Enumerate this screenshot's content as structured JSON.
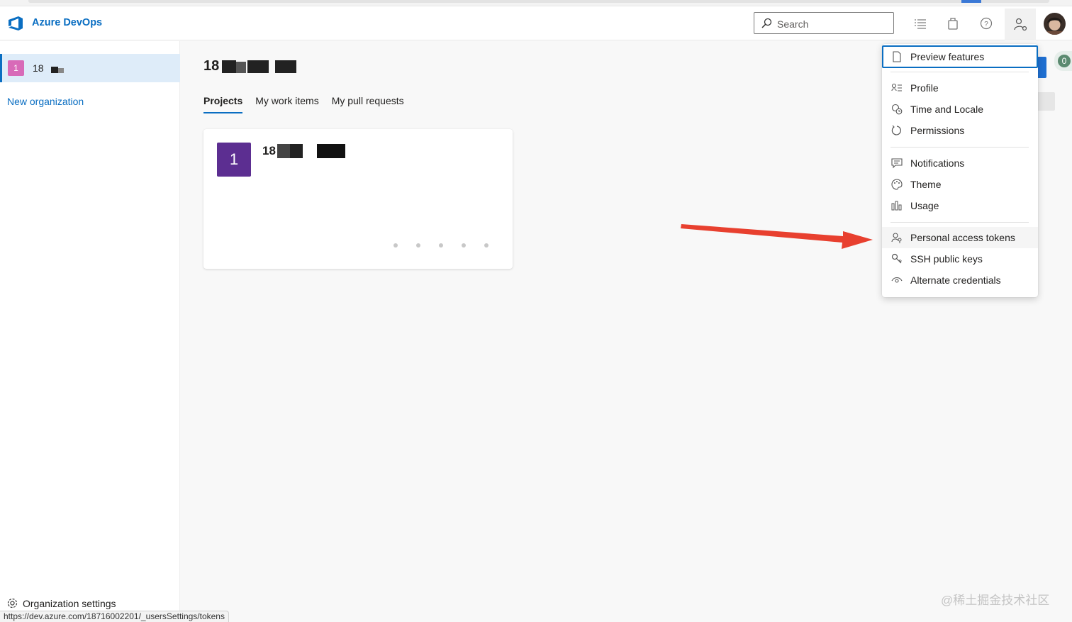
{
  "header": {
    "brand": "Azure DevOps",
    "search_placeholder": "Search",
    "icons": [
      "task-list-icon",
      "marketplace-bag-icon",
      "help-icon",
      "user-settings-icon",
      "avatar"
    ]
  },
  "sidebar": {
    "org_badge": "1",
    "org_name": "18",
    "new_org_label": "New organization",
    "org_settings_label": "Organization settings"
  },
  "main": {
    "org_title": "18",
    "tabs": [
      "Projects",
      "My work items",
      "My pull requests"
    ],
    "project": {
      "badge": "1",
      "name": "18"
    },
    "notification_count": "0"
  },
  "user_menu": {
    "items": [
      {
        "label": "Preview features",
        "icon": "document-icon"
      },
      {
        "label": "Profile",
        "icon": "profile-icon"
      },
      {
        "label": "Time and Locale",
        "icon": "globe-clock-icon"
      },
      {
        "label": "Permissions",
        "icon": "refresh-circle-icon"
      },
      {
        "label": "Notifications",
        "icon": "comment-icon"
      },
      {
        "label": "Theme",
        "icon": "palette-icon"
      },
      {
        "label": "Usage",
        "icon": "bar-chart-icon"
      },
      {
        "label": "Personal access tokens",
        "icon": "person-key-icon"
      },
      {
        "label": "SSH public keys",
        "icon": "key-icon"
      },
      {
        "label": "Alternate credentials",
        "icon": "eye-icon"
      }
    ]
  },
  "status_bar_url": "https://dev.azure.com/18716002201/_usersSettings/tokens",
  "watermark": "@稀土掘金技术社区",
  "colors": {
    "accent": "#0a6ec2",
    "org_badge": "#d86ab8",
    "project_badge": "#5c2e91",
    "arrow": "#e8402f"
  }
}
